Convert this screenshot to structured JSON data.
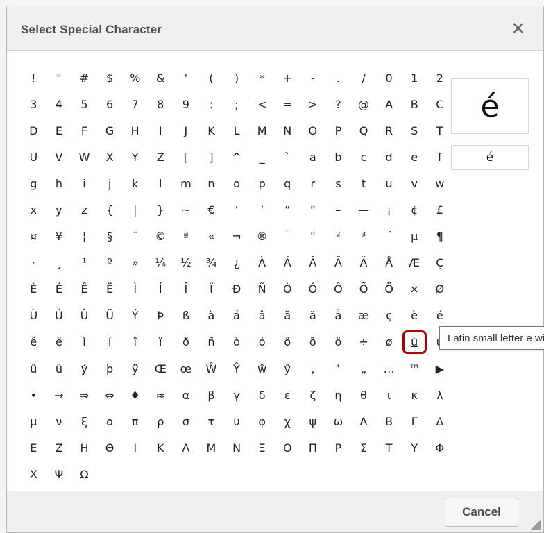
{
  "dialog": {
    "title": "Select Special Character",
    "close_icon": "close-icon",
    "preview_char": "é",
    "html_code": "é",
    "tooltip": "Latin small letter e with acute",
    "cancel_label": "Cancel",
    "selected_index": 185,
    "accent_color": "#b00000"
  },
  "characters": [
    "!",
    "\"",
    "#",
    "$",
    "%",
    "&",
    "'",
    "(",
    ")",
    "*",
    "+",
    "-",
    ".",
    "/",
    "0",
    "1",
    "2",
    "3",
    "4",
    "5",
    "6",
    "7",
    "8",
    "9",
    ":",
    ";",
    "<",
    "=",
    ">",
    "?",
    "@",
    "A",
    "B",
    "C",
    "D",
    "E",
    "F",
    "G",
    "H",
    "I",
    "J",
    "K",
    "L",
    "M",
    "N",
    "O",
    "P",
    "Q",
    "R",
    "S",
    "T",
    "U",
    "V",
    "W",
    "X",
    "Y",
    "Z",
    "[",
    "]",
    "^",
    "_",
    "`",
    "a",
    "b",
    "c",
    "d",
    "e",
    "f",
    "g",
    "h",
    "i",
    "j",
    "k",
    "l",
    "m",
    "n",
    "o",
    "p",
    "q",
    "r",
    "s",
    "t",
    "u",
    "v",
    "w",
    "x",
    "y",
    "z",
    "{",
    "|",
    "}",
    "~",
    "€",
    "‘",
    "’",
    "“",
    "”",
    "–",
    "—",
    "¡",
    "¢",
    "£",
    "¤",
    "¥",
    "¦",
    "§",
    "¨",
    "©",
    "ª",
    "«",
    "¬",
    "®",
    "¯",
    "°",
    "²",
    "³",
    "´",
    "µ",
    "¶",
    "·",
    "¸",
    "¹",
    "º",
    "»",
    "¼",
    "½",
    "¾",
    "¿",
    "À",
    "Á",
    "Â",
    "Ã",
    "Ä",
    "Å",
    "Æ",
    "Ç",
    "È",
    "É",
    "Ê",
    "Ë",
    "Ì",
    "Í",
    "Î",
    "Ï",
    "Ð",
    "Ñ",
    "Ò",
    "Ó",
    "Ô",
    "Õ",
    "Ö",
    "×",
    "Ø",
    "Ù",
    "Ú",
    "Û",
    "Ü",
    "Ý",
    "Þ",
    "ß",
    "à",
    "á",
    "â",
    "ã",
    "ä",
    "å",
    "æ",
    "ç",
    "è",
    "é",
    "ê",
    "ë",
    "ì",
    "í",
    "î",
    "ï",
    "ð",
    "ñ",
    "ò",
    "ó",
    "ô",
    "õ",
    "ö",
    "÷",
    "ø",
    "ù",
    "ú",
    "û",
    "ü",
    "ý",
    "þ",
    "ÿ",
    "Œ",
    "œ",
    "Ŵ",
    "Ŷ",
    "ŵ",
    "ŷ",
    "‚",
    "‛",
    "„",
    "…",
    "™",
    "▶",
    "•",
    "→",
    "⇒",
    "⇔",
    "♦",
    "≈",
    "α",
    "β",
    "γ",
    "δ",
    "ε",
    "ζ",
    "η",
    "θ",
    "ι",
    "κ",
    "λ",
    "μ",
    "ν",
    "ξ",
    "ο",
    "π",
    "ρ",
    "σ",
    "τ",
    "υ",
    "φ",
    "χ",
    "ψ",
    "ω",
    "Α",
    "Β",
    "Γ",
    "Δ",
    "Ε",
    "Ζ",
    "Η",
    "Θ",
    "Ι",
    "Κ",
    "Λ",
    "Μ",
    "Ν",
    "Ξ",
    "Ο",
    "Π",
    "Ρ",
    "Σ",
    "Τ",
    "Υ",
    "Φ",
    "Χ",
    "Ψ",
    "Ω"
  ]
}
